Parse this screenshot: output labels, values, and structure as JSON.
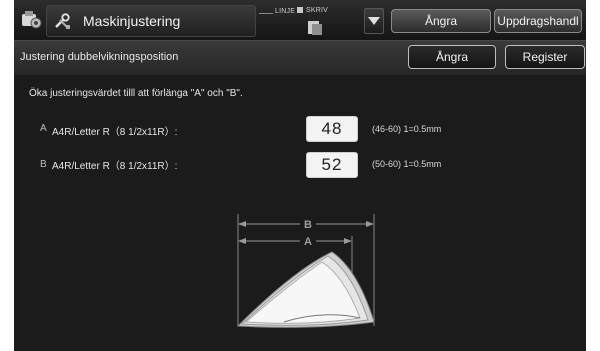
{
  "header": {
    "title": "Maskinjustering",
    "indicator_line": "LINJE",
    "indicator_print": "SKRIV",
    "undo_label": "Ångra",
    "job_label": "Uppdragshandl"
  },
  "subheader": {
    "title": "Justering dubbelvikningsposition",
    "undo_label": "Ångra",
    "register_label": "Register"
  },
  "main": {
    "instruction": "Öka justeringsvärdet tilll att förlänga \"A\" och \"B\".",
    "rows": [
      {
        "letter": "A",
        "label": "A4R/Letter R（8 1/2x11R）:",
        "value": "48",
        "range": "(46-60) 1=0.5mm"
      },
      {
        "letter": "B",
        "label": "A4R/Letter R（8 1/2x11R）:",
        "value": "52",
        "range": "(50-60) 1=0.5mm"
      }
    ],
    "diagram": {
      "label_b": "B",
      "label_a": "A"
    }
  }
}
